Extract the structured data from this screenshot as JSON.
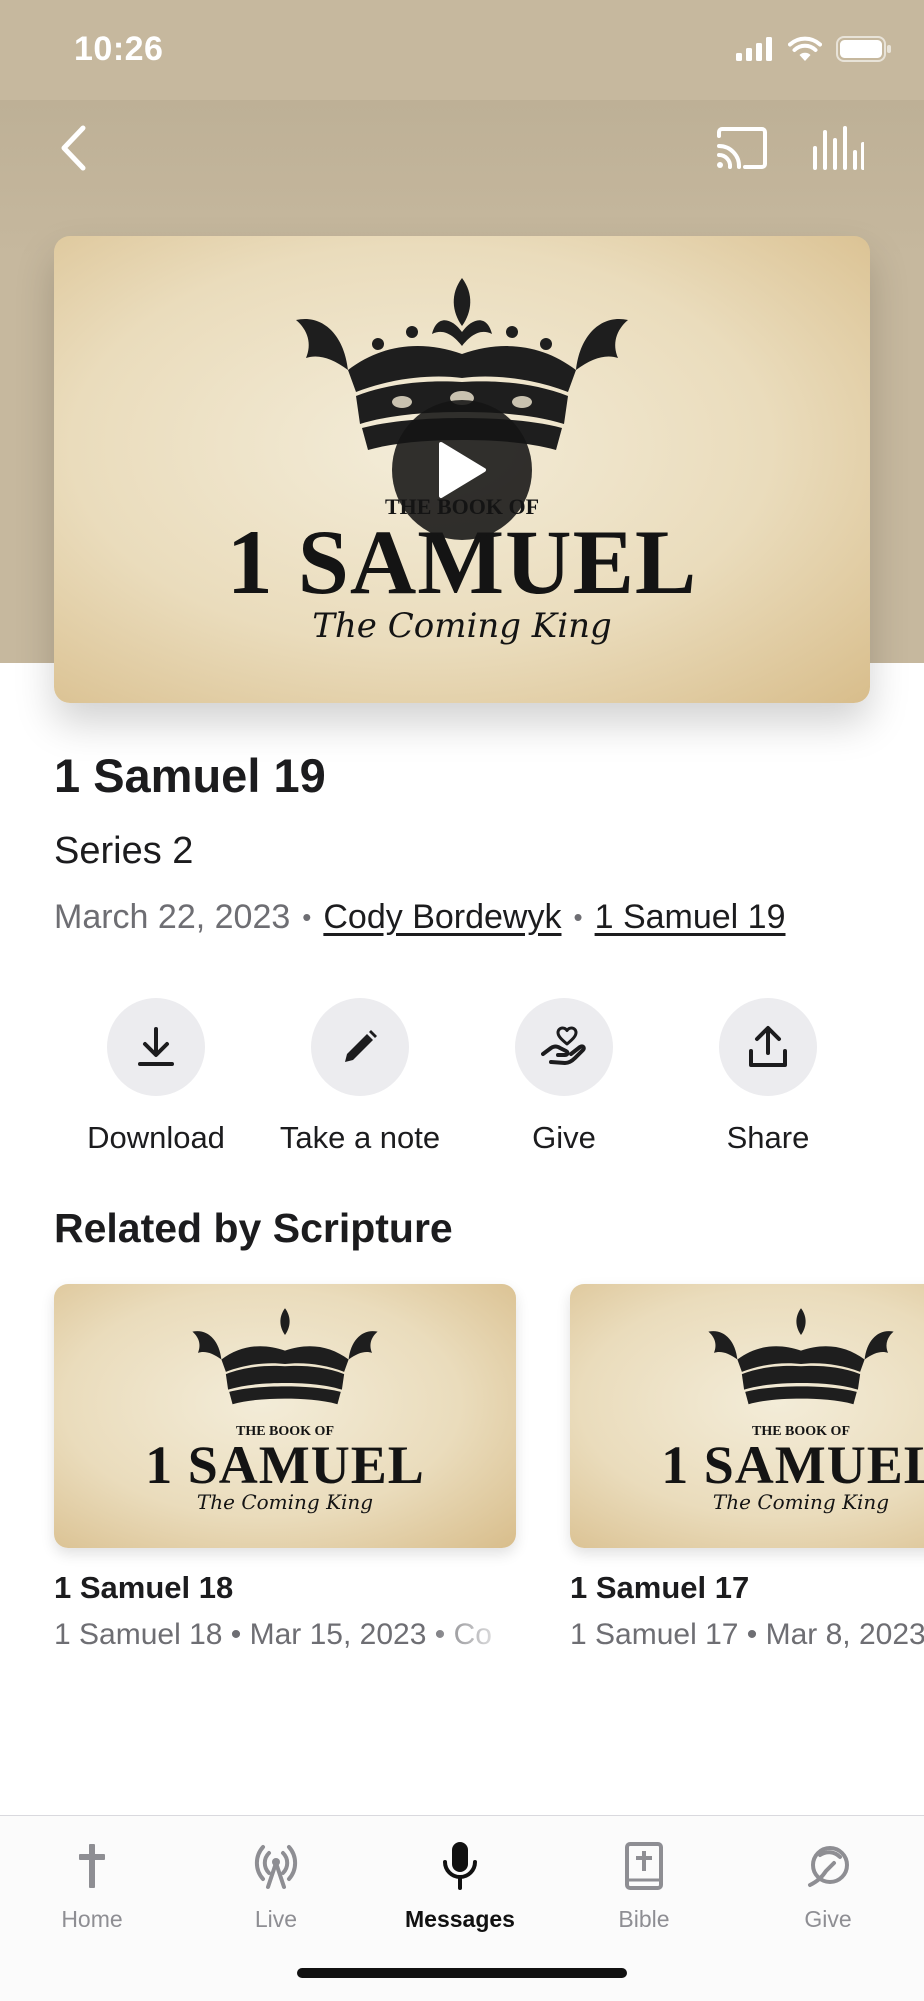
{
  "status_bar": {
    "time": "10:26"
  },
  "hero": {
    "art": {
      "book_of": "THE BOOK OF",
      "title": "1 SAMUEL",
      "subtitle": "The Coming King"
    }
  },
  "message": {
    "title": "1 Samuel 19",
    "series": "Series 2",
    "date": "March 22, 2023",
    "speaker": "Cody Bordewyk",
    "scripture": "1 Samuel 19"
  },
  "actions": [
    {
      "label": "Download",
      "icon": "download-icon"
    },
    {
      "label": "Take a note",
      "icon": "pencil-icon"
    },
    {
      "label": "Give",
      "icon": "give-hand-heart-icon"
    },
    {
      "label": "Share",
      "icon": "share-icon"
    }
  ],
  "related": {
    "heading": "Related by Scripture",
    "items": [
      {
        "title": "1 Samuel 18",
        "meta": "1 Samuel 18 • Mar 15, 2023 • Co"
      },
      {
        "title": "1 Samuel 17",
        "meta": "1 Samuel 17 • Mar 8, 2023"
      }
    ]
  },
  "tabs": [
    {
      "label": "Home",
      "icon": "cross-icon",
      "active": false
    },
    {
      "label": "Live",
      "icon": "broadcast-icon",
      "active": false
    },
    {
      "label": "Messages",
      "icon": "microphone-icon",
      "active": true
    },
    {
      "label": "Bible",
      "icon": "bible-icon",
      "active": false
    },
    {
      "label": "Give",
      "icon": "give-icon",
      "active": false
    }
  ],
  "colors": {
    "hero_background": "#c6b89e",
    "text_primary": "#1c1c1e",
    "text_secondary": "#6e6e73",
    "action_circle": "#ececef",
    "tab_inactive": "#8e8e93",
    "tab_active": "#111111"
  }
}
